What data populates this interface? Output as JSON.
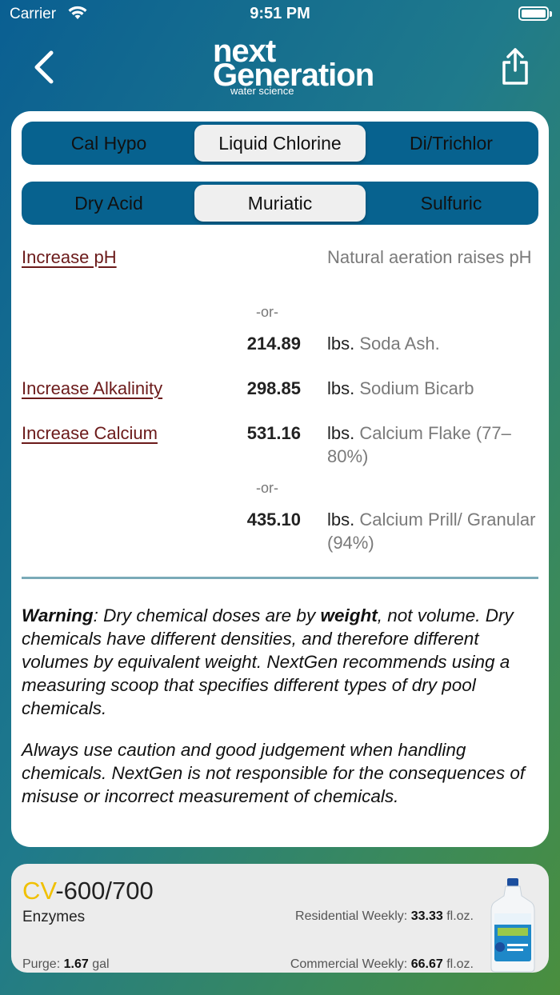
{
  "status": {
    "carrier": "Carrier",
    "time": "9:51 PM"
  },
  "logo": {
    "line1": "next",
    "line2": "Generation",
    "line3": "water science"
  },
  "chlorine_tabs": [
    {
      "label": "Cal Hypo",
      "selected": false
    },
    {
      "label": "Liquid Chlorine",
      "selected": true
    },
    {
      "label": "Di/Trichlor",
      "selected": false
    }
  ],
  "acid_tabs": [
    {
      "label": "Dry Acid",
      "selected": false
    },
    {
      "label": "Muriatic",
      "selected": true
    },
    {
      "label": "Sulfuric",
      "selected": false
    }
  ],
  "results": {
    "ph": {
      "label": "Increase pH",
      "natural": "Natural aeration raises pH",
      "or": "-or-",
      "amount": "214.89",
      "unit": "lbs.",
      "product": "Soda Ash."
    },
    "alkalinity": {
      "label": "Increase Alkalinity",
      "amount": "298.85",
      "unit": "lbs.",
      "product": "Sodium Bicarb"
    },
    "calcium": {
      "label": "Increase Calcium",
      "amount1": "531.16",
      "unit": "lbs.",
      "product1": "Calcium Flake (77–80%)",
      "or": "-or-",
      "amount2": "435.10",
      "product2": "Calcium Prill/ Granular (94%)"
    }
  },
  "warning": {
    "w_label": "Warning",
    "w_text1": ": Dry chemical doses are by ",
    "w_bold": "weight",
    "w_text2": ", not volume. Dry chemicals have different densities, and therefore different volumes by equivalent weight. NextGen recommends using a measuring scoop that specifies different types of dry pool chemicals.",
    "caution": "Always use caution and good judgement when handling chemicals. NextGen is not responsible for the consequences of misuse or incorrect measurement of chemicals."
  },
  "product": {
    "title_prefix": "CV",
    "title_rest": "-600/700",
    "subtitle": "Enzymes",
    "purge_label": "Purge:",
    "purge_value": "1.67",
    "purge_unit": "gal",
    "res_label": "Residential Weekly:",
    "res_value": "33.33",
    "res_unit": "fl.oz.",
    "com_label": "Commercial Weekly:",
    "com_value": "66.67",
    "com_unit": "fl.oz."
  },
  "colors": {
    "segment_bg": "#07628f",
    "link": "#6b1a1a",
    "accent_yellow": "#f0c000"
  }
}
